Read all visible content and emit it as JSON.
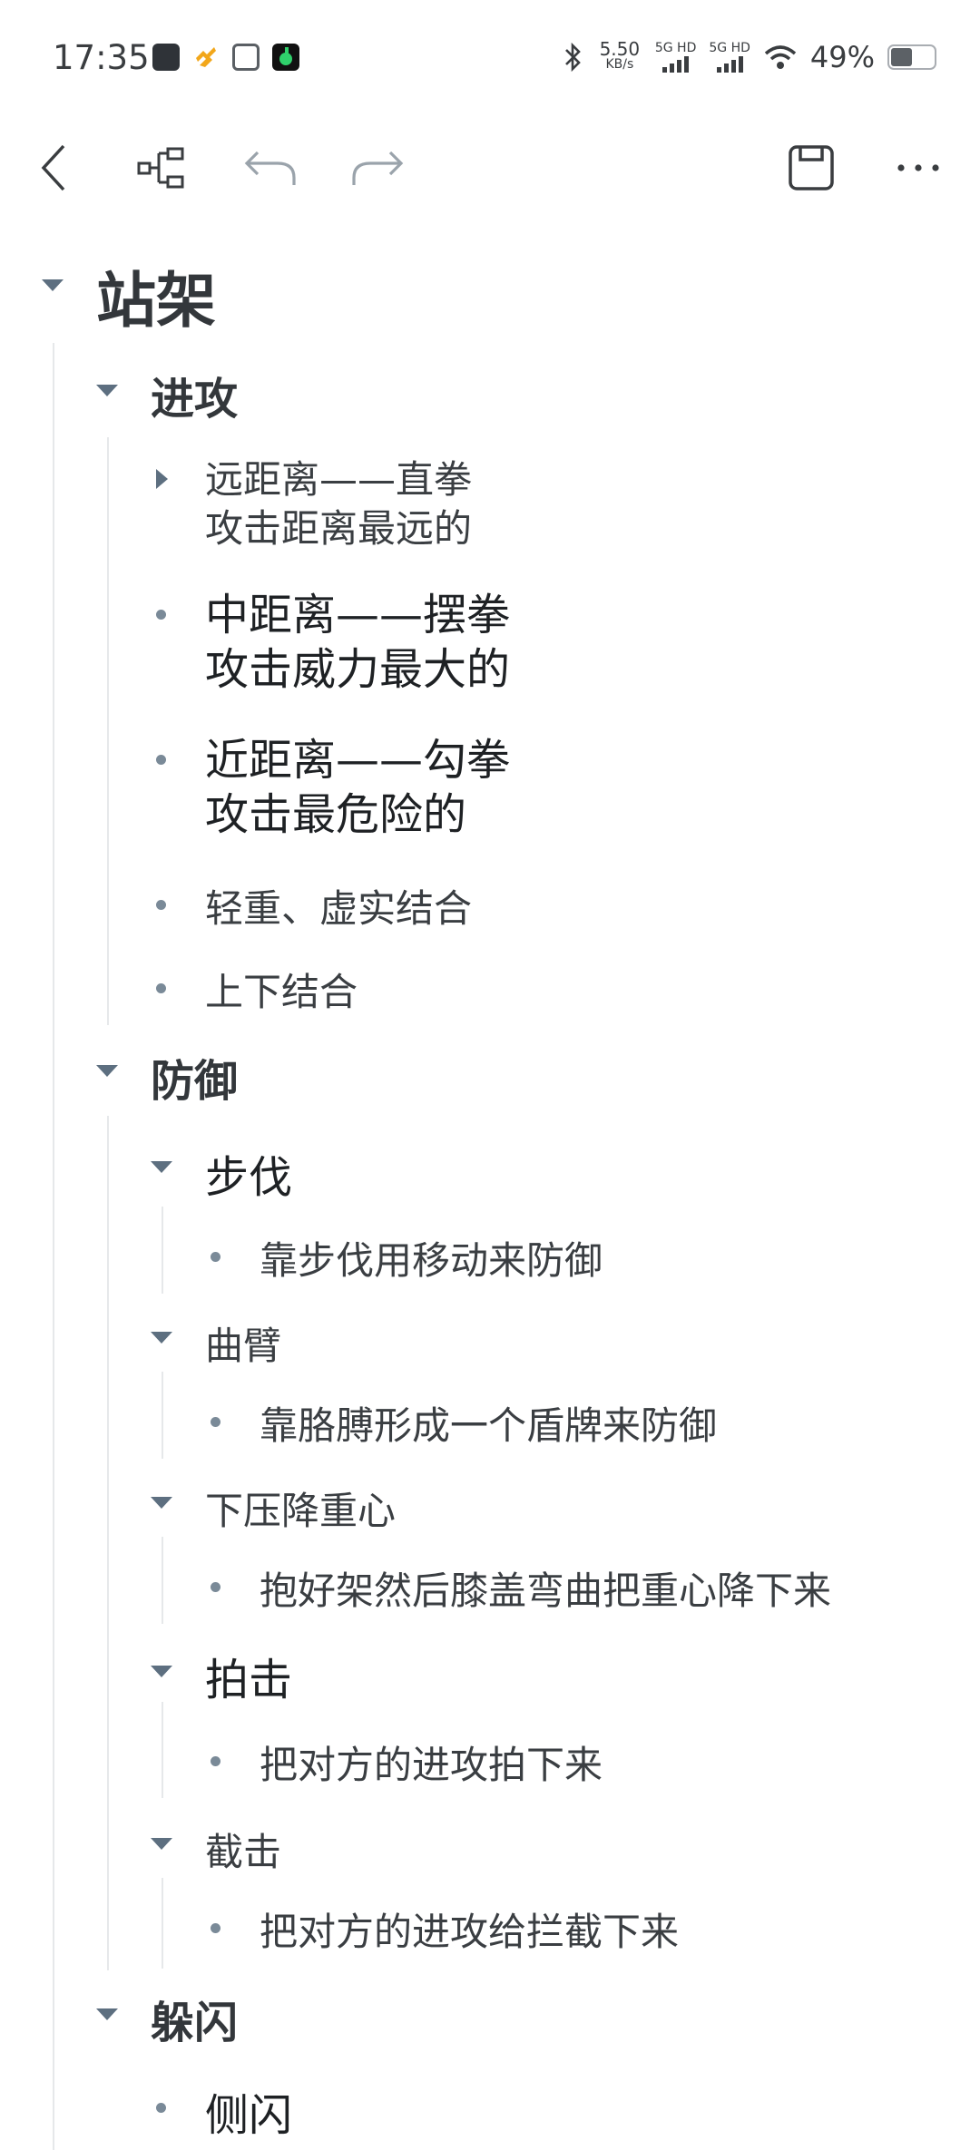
{
  "status_bar": {
    "time": "17:35",
    "net_speed_value": "5.50",
    "net_speed_unit": "KB/s",
    "sim1_label": "5G HD",
    "sim2_label": "5G HD",
    "battery_percent": "49%",
    "battery_level": 0.49
  },
  "toolbar": {
    "icons": [
      "back-icon",
      "mindmap-icon",
      "undo-icon",
      "redo-icon",
      "save-icon",
      "more-icon"
    ]
  },
  "outline": {
    "root": "站架",
    "attack": {
      "title": "进攻",
      "long_line1": "远距离——直拳",
      "long_line2": "攻击距离最远的",
      "mid_line1": "中距离——摆拳",
      "mid_line2": "攻击威力最大的",
      "short_line1": "近距离——勾拳",
      "short_line2": "攻击最危险的",
      "combo1": "轻重、虚实结合",
      "combo2": "上下结合"
    },
    "defense": {
      "title": "防御",
      "footwork": "步伐",
      "footwork_note": "靠步伐用移动来防御",
      "arm": "曲臂",
      "arm_note": "靠胳膊形成一个盾牌来防御",
      "lower": "下压降重心",
      "lower_note": "抱好架然后膝盖弯曲把重心降下来",
      "parry": "拍击",
      "parry_note": "把对方的进攻拍下来",
      "intercept": "截击",
      "intercept_note": "把对方的进攻给拦截下来"
    },
    "evade": {
      "title": "躲闪",
      "side": "侧闪"
    }
  },
  "colors": {
    "bullet": "#7a8a98",
    "triangle": "#5d6f80",
    "guide": "#e6e8ea",
    "text": "#33373b"
  }
}
